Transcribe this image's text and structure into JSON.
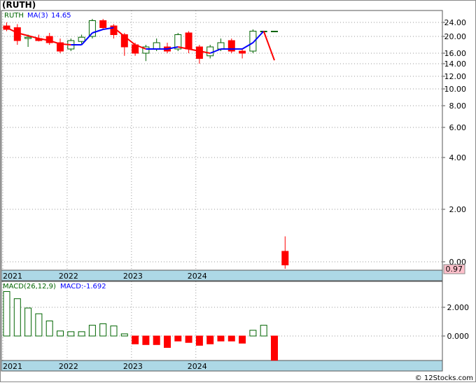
{
  "header": {
    "title": "(RUTH)",
    "footer": "© 12Stocks.com"
  },
  "colors": {
    "up": "#006400",
    "down": "#ff0000",
    "ma_up": "#0000ff",
    "ma_down": "#ff0000",
    "axis_band": "#add8e6",
    "grid": "#999999",
    "frame": "#555555",
    "last_price_box": "#ffc0cb"
  },
  "chart_data": [
    {
      "type": "candlestick",
      "title": "",
      "legend": {
        "symbol": "RUTH",
        "ma_label": "MA(3)",
        "ma_value": "14.65"
      },
      "y_scale": "log",
      "y_ticks": [
        {
          "value": 24,
          "label": "24.00"
        },
        {
          "value": 20,
          "label": "20.00"
        },
        {
          "value": 16,
          "label": "16.00"
        },
        {
          "value": 14,
          "label": "14.00"
        },
        {
          "value": 12,
          "label": "12.00"
        },
        {
          "value": 10,
          "label": "10.00"
        },
        {
          "value": 8,
          "label": "8.00"
        },
        {
          "value": 6,
          "label": "6.00"
        },
        {
          "value": 4,
          "label": "4.00"
        },
        {
          "value": 2,
          "label": "2.00"
        },
        {
          "value": 0,
          "label": "0.00"
        }
      ],
      "last_price_label": "0.97",
      "x_labels": [
        "2021",
        "2022",
        "2023",
        "2024"
      ],
      "x_label_month_index": [
        0,
        12,
        24,
        36
      ],
      "candles": [
        {
          "o": 23.0,
          "h": 24.0,
          "l": 21.5,
          "c": 22.0
        },
        {
          "o": 22.5,
          "h": 23.5,
          "l": 18.0,
          "c": 19.0
        },
        {
          "o": 19.5,
          "h": 20.5,
          "l": 17.5,
          "c": 19.8
        },
        {
          "o": 19.5,
          "h": 20.5,
          "l": 18.8,
          "c": 19.0
        },
        {
          "o": 20.0,
          "h": 21.0,
          "l": 18.0,
          "c": 18.5
        },
        {
          "o": 18.5,
          "h": 19.5,
          "l": 16.0,
          "c": 16.5
        },
        {
          "o": 17.0,
          "h": 19.5,
          "l": 16.5,
          "c": 19.0
        },
        {
          "o": 18.8,
          "h": 20.5,
          "l": 18.0,
          "c": 19.8
        },
        {
          "o": 20.0,
          "h": 25.0,
          "l": 19.5,
          "c": 24.5
        },
        {
          "o": 24.5,
          "h": 25.0,
          "l": 22.0,
          "c": 22.5
        },
        {
          "o": 23.0,
          "h": 23.5,
          "l": 19.5,
          "c": 20.5
        },
        {
          "o": 20.5,
          "h": 21.0,
          "l": 15.5,
          "c": 17.5
        },
        {
          "o": 18.0,
          "h": 18.5,
          "l": 15.5,
          "c": 16.0
        },
        {
          "o": 16.0,
          "h": 18.0,
          "l": 14.5,
          "c": 17.5
        },
        {
          "o": 17.0,
          "h": 19.5,
          "l": 16.5,
          "c": 18.5
        },
        {
          "o": 17.5,
          "h": 18.5,
          "l": 16.0,
          "c": 16.5
        },
        {
          "o": 17.0,
          "h": 21.0,
          "l": 16.5,
          "c": 20.5
        },
        {
          "o": 21.0,
          "h": 21.5,
          "l": 16.0,
          "c": 17.0
        },
        {
          "o": 17.5,
          "h": 18.0,
          "l": 14.0,
          "c": 15.0
        },
        {
          "o": 15.5,
          "h": 18.0,
          "l": 15.0,
          "c": 17.5
        },
        {
          "o": 17.0,
          "h": 19.5,
          "l": 16.5,
          "c": 18.5
        },
        {
          "o": 19.0,
          "h": 19.5,
          "l": 16.0,
          "c": 16.5
        },
        {
          "o": 16.5,
          "h": 17.0,
          "l": 15.0,
          "c": 16.0
        },
        {
          "o": 16.5,
          "h": 22.0,
          "l": 16.0,
          "c": 21.5
        },
        {
          "o": 21.5,
          "h": 21.5,
          "l": 21.5,
          "c": 21.5
        },
        {
          "o": 21.5,
          "h": 21.5,
          "l": 21.5,
          "c": 21.5
        },
        {
          "o": 0.4,
          "h": 0.97,
          "l": -0.55,
          "c": -0.25
        }
      ],
      "ma": [
        22.5,
        21.0,
        20.2,
        19.5,
        19.0,
        18.2,
        18.0,
        18.0,
        21.0,
        22.0,
        22.5,
        20.0,
        18.0,
        17.0,
        17.0,
        17.0,
        17.5,
        17.0,
        16.5,
        16.0,
        17.0,
        17.0,
        17.0,
        18.5,
        21.5,
        14.65
      ]
    },
    {
      "type": "bar",
      "title": "",
      "legend": {
        "params_label": "MACD(26,12,9)",
        "value_label": "MACD:-1.692"
      },
      "y_ticks": [
        {
          "value": 2,
          "label": "2.000"
        },
        {
          "value": 0,
          "label": "0.000"
        }
      ],
      "x_labels": [
        "2021",
        "2022",
        "2023",
        "2024"
      ],
      "values": [
        3.1,
        2.6,
        1.95,
        1.55,
        1.05,
        0.35,
        0.3,
        0.3,
        0.75,
        0.85,
        0.7,
        0.15,
        -0.55,
        -0.6,
        -0.6,
        -0.8,
        -0.35,
        -0.45,
        -0.65,
        -0.55,
        -0.35,
        -0.35,
        -0.5,
        0.4,
        0.75,
        -1.692
      ]
    }
  ]
}
